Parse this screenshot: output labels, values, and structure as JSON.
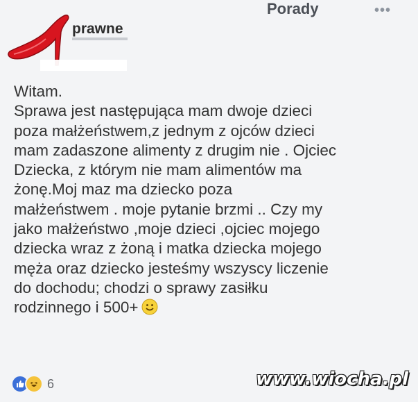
{
  "header": {
    "group_name": "Porady",
    "more_icon": "more-dots-icon"
  },
  "author": {
    "name": "prawne",
    "avatar_icon": "red-high-heel-icon",
    "avatar_color": "#d7151f"
  },
  "post": {
    "text": "Witam.\nSprawa jest następująca mam dwoje dzieci\npoza małżeństwem,z jednym z ojców dzieci\nmam zadaszone alimenty z drugim nie . Ojciec\nDziecka, z którym nie mam alimentów ma\nżonę.Moj maz ma dziecko poza\nmałżeństwem  . moje pytanie brzmi .. Czy my\njako małżeństwo ,moje dzieci ,ojciec mojego\ndziecka wraz z żoną i matka dziecka mojego\nmęża oraz dziecko jesteśmy wszyscy liczenie\ndo dochodu; chodzi o sprawy zasiłku\nrodzinnego i 500+",
    "emoji_icon": "smiley-face-icon"
  },
  "reactions": {
    "count": "6",
    "icons": [
      "like-icon",
      "haha-icon"
    ],
    "like_color": "#3b6fd8",
    "haha_color": "#f5c33b"
  },
  "watermark": {
    "text": "www.wiocha.pl"
  }
}
